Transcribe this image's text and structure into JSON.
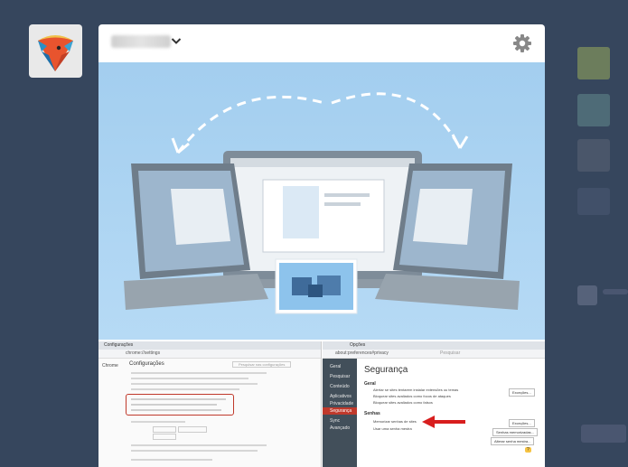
{
  "dashboard": {
    "avatar_icon": "ice-cream-cone-logo-icon",
    "post": {
      "settings_icon": "gear-icon",
      "dropdown_icon": "chevron-down-icon"
    }
  },
  "screenshot_left": {
    "tab_title": "Configurações",
    "address": "chrome://settings",
    "sidebar_title": "Chrome",
    "page_heading": "Configurações",
    "search_placeholder": "Pesquisar nas configurações"
  },
  "screenshot_right": {
    "tab_title": "Opções",
    "address": "about:preferences#privacy",
    "search_placeholder": "Pesquisar",
    "heading": "Segurança",
    "sidebar_items": [
      "Geral",
      "Pesquisar",
      "Conteúdo",
      "Aplicativos",
      "Privacidade",
      "Segurança",
      "Sync",
      "Avançado"
    ],
    "section_geral": "Geral",
    "geral_options": [
      "Alertar se sites tentarem instalar extensões ou temas",
      "Bloquear sites avaliados como focos de ataques",
      "Bloquear sites avaliados como falsos"
    ],
    "excecoes_button": "Exceções...",
    "section_senhas": "Senhas",
    "senhas_options": [
      "Memorizar senhas de sites",
      "Usar uma senha mestra"
    ],
    "senhas_buttons": [
      "Exceções...",
      "Senhas memorizadas...",
      "Alterar senha mestra..."
    ],
    "help_button": "?"
  }
}
